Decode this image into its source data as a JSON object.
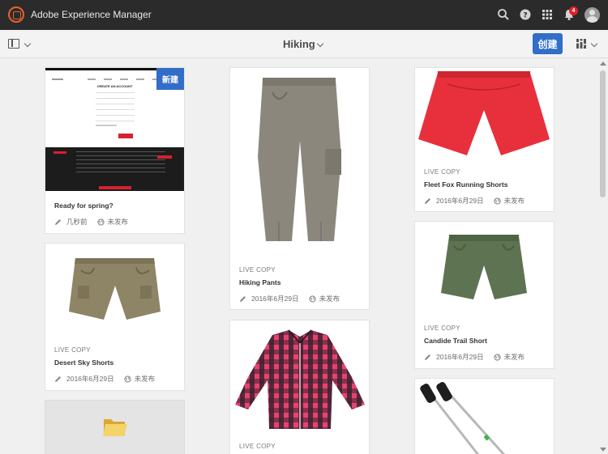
{
  "app": {
    "title": "Adobe Experience Manager"
  },
  "topbar": {
    "notification_count": "4"
  },
  "actionbar": {
    "breadcrumb": "Hiking",
    "create_label": "创建"
  },
  "cards": {
    "spring": {
      "title": "Ready for spring?",
      "modified": "几秒前",
      "status": "未发布",
      "badge": "新建"
    },
    "hiking_pants": {
      "label": "LIVE COPY",
      "title": "Hiking Pants",
      "modified": "2016年6月29日",
      "status": "未发布"
    },
    "fleet_fox": {
      "label": "LIVE COPY",
      "title": "Fleet Fox Running Shorts",
      "modified": "2016年6月29日",
      "status": "未发布"
    },
    "desert_sky": {
      "label": "LIVE COPY",
      "title": "Desert Sky Shorts",
      "modified": "2016年6月29日",
      "status": "未发布"
    },
    "candide": {
      "label": "LIVE COPY",
      "title": "Candide Trail Short",
      "modified": "2016年6月29日",
      "status": "未发布"
    },
    "shirt": {
      "label": "LIVE COPY"
    }
  },
  "website_preview": {
    "heading": "CREATE AN ACCOUNT"
  },
  "colors": {
    "accent": "#326ec8",
    "topbar": "#2b2b2b",
    "notification": "#e2202b"
  },
  "icons": [
    "aem-logo-icon",
    "search-icon",
    "help-icon",
    "apps-grid-icon",
    "bell-icon",
    "avatar",
    "rail-toggle-icon",
    "chevron-down-icon",
    "view-switch-icon",
    "pencil-icon",
    "globe-icon",
    "folder-icon"
  ]
}
